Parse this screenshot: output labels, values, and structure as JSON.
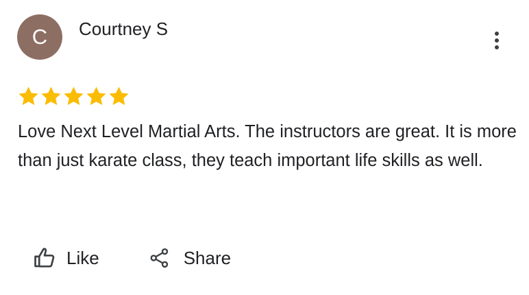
{
  "author": {
    "initial": "C",
    "name": "Courtney S",
    "avatar_color": "#8d6e63"
  },
  "more_options": {
    "icon": "more-vert-icon"
  },
  "rating": {
    "value": 5,
    "max": 5,
    "star_color": "#fbbc04"
  },
  "review": {
    "text": "Love Next Level Martial Arts. The instructors are great. It is more than just karate class, they teach important life skills as well."
  },
  "actions": {
    "like_label": "Like",
    "like_icon": "thumbs-up-icon",
    "share_label": "Share",
    "share_icon": "share-icon"
  },
  "colors": {
    "text": "#202124",
    "icon": "#3c4043",
    "background": "#ffffff"
  }
}
